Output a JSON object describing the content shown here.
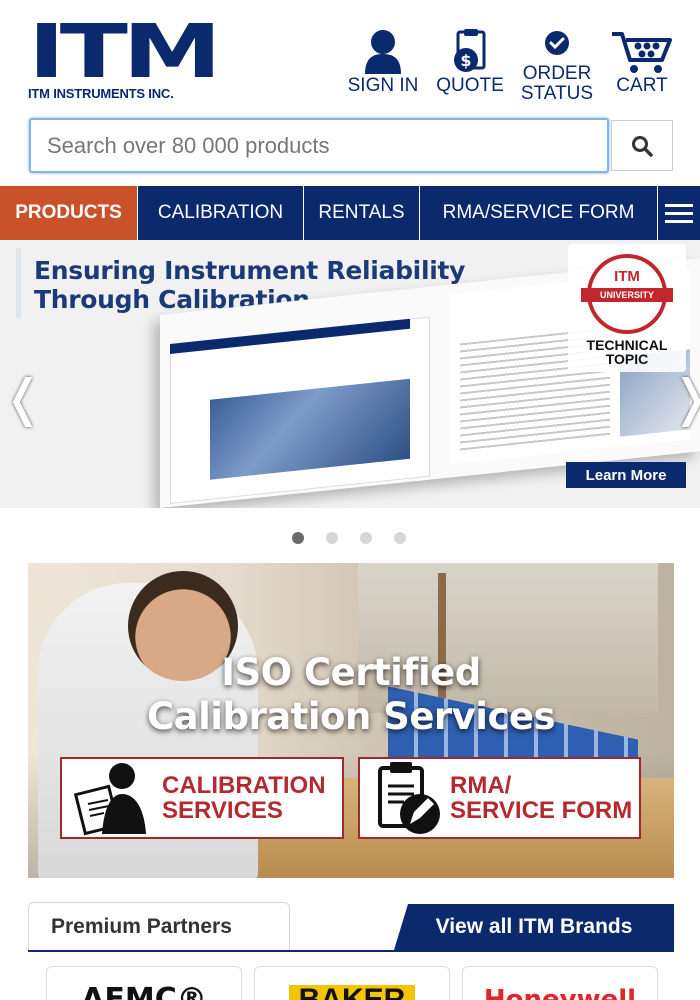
{
  "header": {
    "logo_mark": "ITM",
    "logo_sub": "ITM INSTRUMENTS INC.",
    "nav": {
      "sign_in": "SIGN IN",
      "quote": "QUOTE",
      "order_line1": "ORDER",
      "order_line2": "STATUS",
      "cart": "CART"
    },
    "icons": {
      "sign_in": "user-icon",
      "quote": "quote-clipboard-icon",
      "order": "check-circle-icon",
      "cart": "cart-icon"
    }
  },
  "search": {
    "placeholder": "Search over 80 000 products",
    "value": "",
    "icon": "search-icon"
  },
  "main_nav": {
    "items": [
      {
        "label": "PRODUCTS",
        "active": true
      },
      {
        "label": "CALIBRATION"
      },
      {
        "label": "RENTALS"
      },
      {
        "label": "RMA/SERVICE FORM"
      }
    ],
    "menu_icon": "hamburger-icon"
  },
  "banner": {
    "title_line1": "Ensuring Instrument Reliability",
    "title_line2": "Through Calibration",
    "university_mark": "ITM",
    "university_label": "UNIVERSITY",
    "technical_topic_line1": "TECHNICAL",
    "technical_topic_line2": "TOPIC",
    "learn_more": "Learn More",
    "prev_icon": "chevron-left-icon",
    "next_icon": "chevron-right-icon"
  },
  "carousel": {
    "slide_count": 4,
    "active_index": 0
  },
  "promo": {
    "title_line1": "ISO Certified",
    "title_line2": "Calibration Services",
    "buttons": [
      {
        "line1": "CALIBRATION",
        "line2": "SERVICES",
        "icon": "certificate-technician-icon"
      },
      {
        "line1": "RMA/",
        "line2": "SERVICE FORM",
        "icon": "clipboard-pencil-icon"
      }
    ]
  },
  "partners": {
    "tab_label": "Premium Partners",
    "view_all": "View all ITM Brands",
    "brands": [
      "AEMC®",
      "BAKER",
      "Honeywell"
    ]
  },
  "colors": {
    "brand_navy": "#0b2a6e",
    "accent_orange": "#c9522a",
    "promo_red": "#b32a30"
  }
}
